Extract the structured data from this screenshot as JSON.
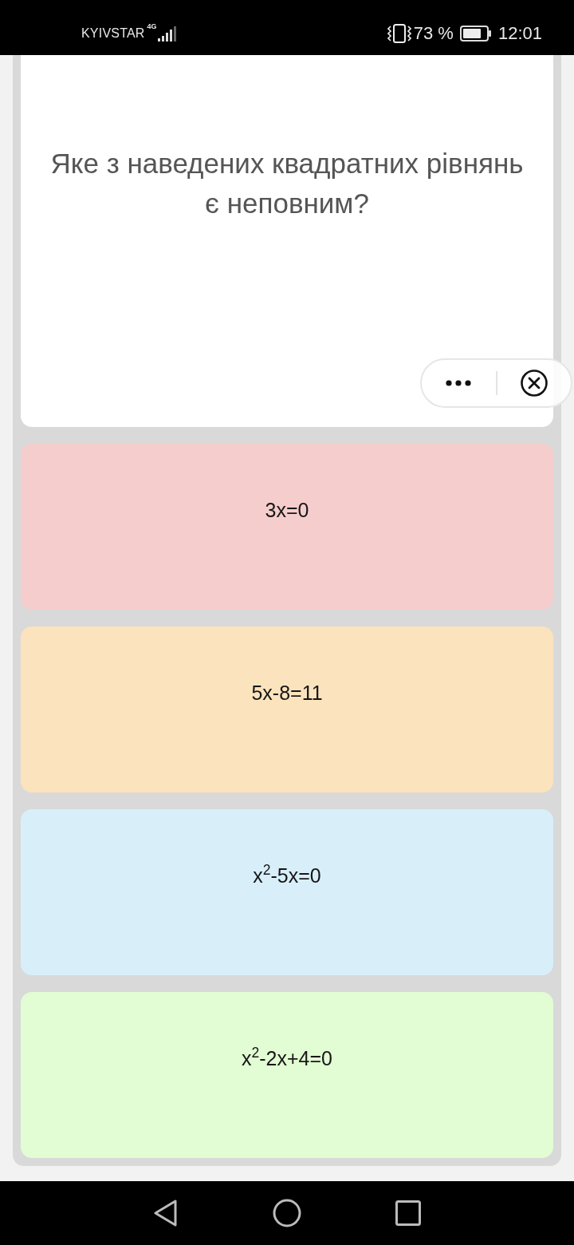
{
  "status_bar": {
    "carrier": "KYIVSTAR",
    "network": "4G",
    "battery": "73 %",
    "time": "12:01"
  },
  "question": {
    "text": "Яке з наведених квадратних рівнянь є неповним?"
  },
  "options": [
    {
      "text": "3x=0",
      "color": "#f6cdcd"
    },
    {
      "text": "5x-8=11",
      "color": "#fbe3bd"
    },
    {
      "text": "x$^{2}$-5x=0",
      "color": "#d8effa"
    },
    {
      "text": "x$^{2}$-2x+4=0",
      "color": "#e2fcd3"
    }
  ]
}
